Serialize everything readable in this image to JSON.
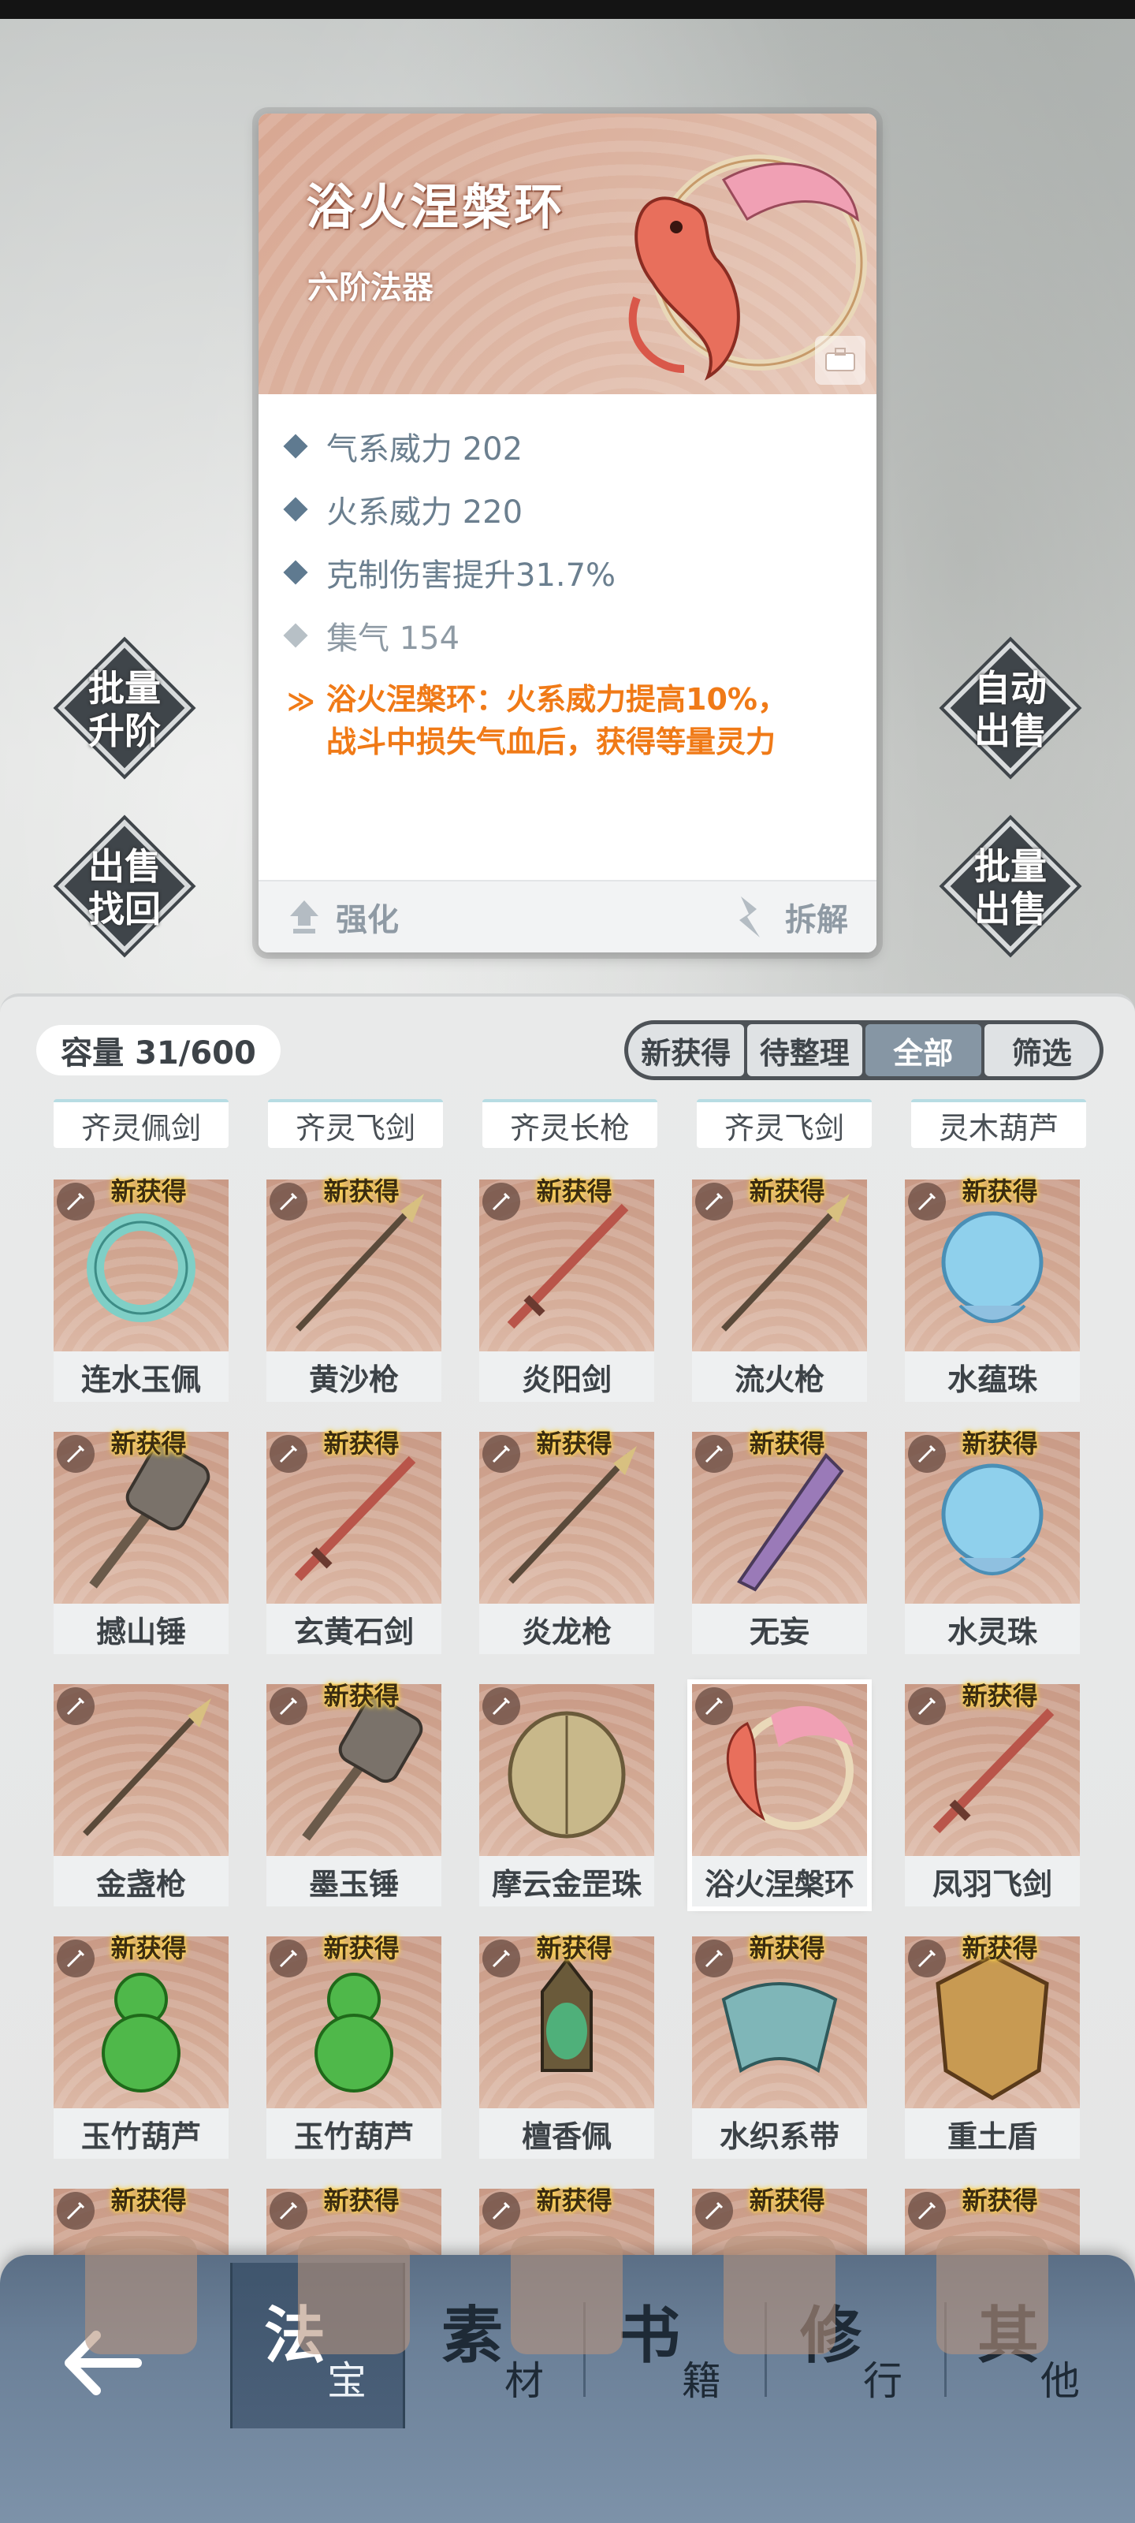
{
  "detail": {
    "title": "浴火涅槃环",
    "tier": "六阶法器",
    "stats": [
      {
        "label": "气系威力 202"
      },
      {
        "label": "火系威力 220"
      },
      {
        "label": "克制伤害提升31.7%"
      },
      {
        "label": "集气 154"
      }
    ],
    "special_line1": "浴火涅槃环：火系威力提高10%，",
    "special_line2": "战斗中损失气血后，获得等量灵力",
    "enhance_label": "强化",
    "dismantle_label": "拆解",
    "colors": {
      "special": "#f07a17",
      "stat": "#6b7f8f"
    }
  },
  "side_buttons": {
    "batch_upgrade": [
      "批量",
      "升阶"
    ],
    "sell_recover": [
      "出售",
      "找回"
    ],
    "auto_sell": [
      "自动",
      "出售"
    ],
    "batch_sell": [
      "批量",
      "出售"
    ]
  },
  "inventory": {
    "capacity_label": "容量 31/600",
    "filter_tabs": [
      "新获得",
      "待整理",
      "全部",
      "筛选"
    ],
    "active_filter": "全部",
    "new_badge": "新获得",
    "categories": [
      "齐灵佩剑",
      "齐灵飞剑",
      "齐灵长枪",
      "齐灵飞剑",
      "灵木葫芦"
    ],
    "items": [
      {
        "name": "连水玉佩",
        "new": true,
        "icon": "jade-ring"
      },
      {
        "name": "黄沙枪",
        "new": true,
        "icon": "spear"
      },
      {
        "name": "炎阳剑",
        "new": true,
        "icon": "sword"
      },
      {
        "name": "流火枪",
        "new": true,
        "icon": "spear"
      },
      {
        "name": "水蕴珠",
        "new": true,
        "icon": "orb"
      },
      {
        "name": "撼山锤",
        "new": true,
        "icon": "hammer"
      },
      {
        "name": "玄黄石剑",
        "new": true,
        "icon": "sword"
      },
      {
        "name": "炎龙枪",
        "new": true,
        "icon": "spear"
      },
      {
        "name": "无妄",
        "new": true,
        "icon": "blade"
      },
      {
        "name": "水灵珠",
        "new": true,
        "icon": "orb"
      },
      {
        "name": "金盏枪",
        "new": false,
        "icon": "spear"
      },
      {
        "name": "墨玉锤",
        "new": true,
        "icon": "hammer"
      },
      {
        "name": "摩云金罡珠",
        "new": false,
        "icon": "shell"
      },
      {
        "name": "浴火涅槃环",
        "new": false,
        "icon": "phoenix-ring",
        "selected": true
      },
      {
        "name": "凤羽飞剑",
        "new": true,
        "icon": "sword"
      },
      {
        "name": "玉竹葫芦",
        "new": true,
        "icon": "gourd"
      },
      {
        "name": "玉竹葫芦",
        "new": true,
        "icon": "gourd"
      },
      {
        "name": "檀香佩",
        "new": true,
        "icon": "pendant"
      },
      {
        "name": "水织系带",
        "new": true,
        "icon": "sash"
      },
      {
        "name": "重土盾",
        "new": true,
        "icon": "shield"
      },
      {
        "name": "",
        "new": true,
        "icon": "partial"
      },
      {
        "name": "",
        "new": true,
        "icon": "partial"
      },
      {
        "name": "",
        "new": true,
        "icon": "partial"
      },
      {
        "name": "",
        "new": true,
        "icon": "partial"
      },
      {
        "name": "",
        "new": true,
        "icon": "partial"
      }
    ]
  },
  "bottom_nav": {
    "tabs": [
      {
        "big": "法",
        "small": "宝",
        "active": true
      },
      {
        "big": "素",
        "small": "材",
        "active": false
      },
      {
        "big": "书",
        "small": "籍",
        "active": false
      },
      {
        "big": "修",
        "small": "行",
        "active": false
      },
      {
        "big": "其",
        "small": "他",
        "active": false
      }
    ]
  }
}
